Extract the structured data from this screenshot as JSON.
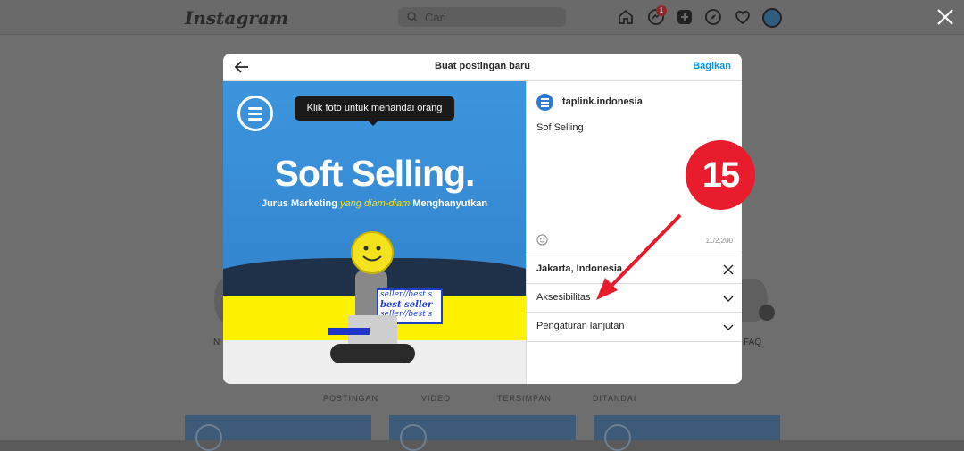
{
  "app": {
    "logo": "Instagram",
    "search_placeholder": "Cari",
    "notification_count": "1"
  },
  "background": {
    "highlights": [
      {
        "label": "N"
      },
      {
        "label": "FAQ"
      }
    ],
    "tabs": {
      "posts": "POSTINGAN",
      "video": "VIDEO",
      "saved": "TERSIMPAN",
      "tagged": "DITANDAI"
    }
  },
  "modal": {
    "title": "Buat postingan baru",
    "share_label": "Bagikan",
    "photo": {
      "tooltip": "Klik foto untuk menandai orang",
      "headline": "Soft Selling.",
      "sub_part1": "Jurus Marketing ",
      "sub_part2": "yang diam-diam",
      "sub_part3": " Menghanyutkan",
      "bubble_line1": "seller//best s",
      "bubble_line2": "best seller",
      "bubble_line3": "seller//best s"
    },
    "account_name": "taplink.indonesia",
    "caption": "Sof Selling",
    "char_count": "11/2,200",
    "location": "Jakarta, Indonesia",
    "accessibility": "Aksesibilitas",
    "advanced": "Pengaturan lanjutan"
  },
  "annotation": {
    "step_number": "15",
    "color": "#e81c2c"
  }
}
